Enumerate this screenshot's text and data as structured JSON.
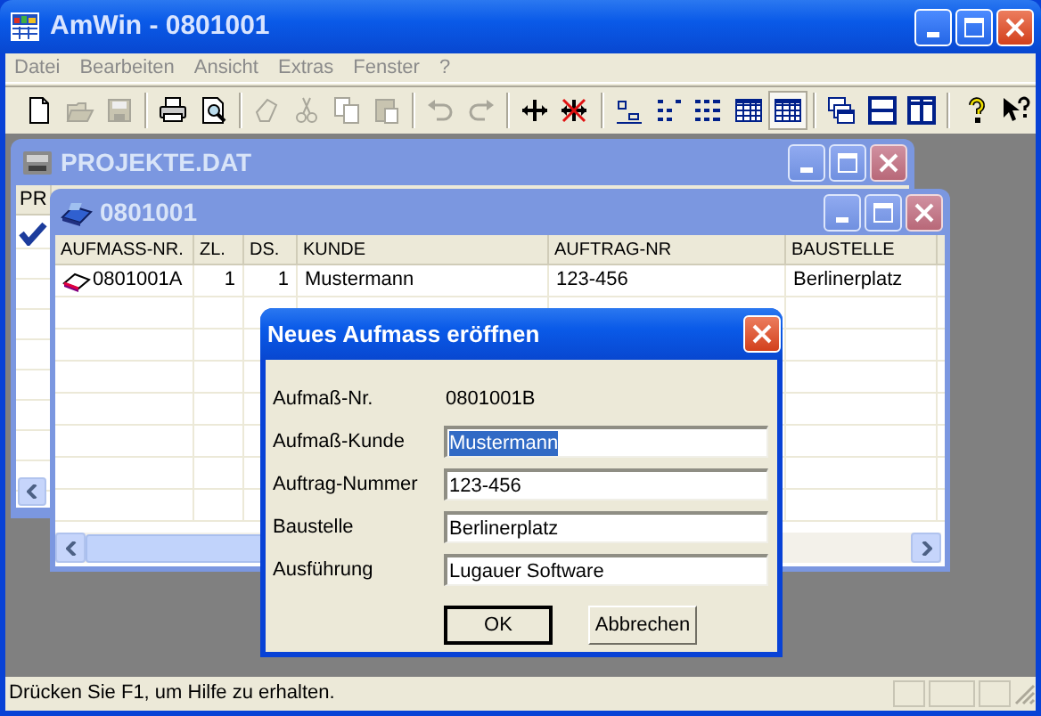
{
  "window": {
    "title": "AmWin - 0801001"
  },
  "menu": [
    "Datei",
    "Bearbeiten",
    "Ansicht",
    "Extras",
    "Fenster",
    "?"
  ],
  "toolbar": [
    {
      "kind": "new",
      "disabled": false,
      "pressed": false
    },
    {
      "kind": "open",
      "disabled": true,
      "pressed": false
    },
    {
      "kind": "save",
      "disabled": true,
      "pressed": false
    },
    {
      "kind": "separator"
    },
    {
      "kind": "print",
      "disabled": false,
      "pressed": false
    },
    {
      "kind": "preview",
      "disabled": false,
      "pressed": false
    },
    {
      "kind": "separator"
    },
    {
      "kind": "wand",
      "disabled": true,
      "pressed": false
    },
    {
      "kind": "cut",
      "disabled": true,
      "pressed": false
    },
    {
      "kind": "copy",
      "disabled": true,
      "pressed": false
    },
    {
      "kind": "paste",
      "disabled": true,
      "pressed": false
    },
    {
      "kind": "separator"
    },
    {
      "kind": "undo",
      "disabled": true,
      "pressed": false
    },
    {
      "kind": "redo",
      "disabled": true,
      "pressed": false
    },
    {
      "kind": "separator"
    },
    {
      "kind": "move",
      "disabled": false,
      "pressed": false
    },
    {
      "kind": "nomove",
      "disabled": false,
      "pressed": false
    },
    {
      "kind": "separator"
    },
    {
      "kind": "level1",
      "disabled": false,
      "pressed": false
    },
    {
      "kind": "level2",
      "disabled": false,
      "pressed": false
    },
    {
      "kind": "level3",
      "disabled": false,
      "pressed": false
    },
    {
      "kind": "grid",
      "disabled": false,
      "pressed": false
    },
    {
      "kind": "grid",
      "disabled": false,
      "pressed": true
    },
    {
      "kind": "separator"
    },
    {
      "kind": "cascade",
      "disabled": false,
      "pressed": false
    },
    {
      "kind": "tileh",
      "disabled": false,
      "pressed": false
    },
    {
      "kind": "tilev",
      "disabled": false,
      "pressed": false
    },
    {
      "kind": "separator"
    },
    {
      "kind": "help",
      "disabled": false,
      "pressed": false
    },
    {
      "kind": "whatsthis",
      "disabled": false,
      "pressed": false
    }
  ],
  "child_windows": [
    {
      "title": "PROJEKTE.DAT",
      "columns": [
        "PR"
      ]
    },
    {
      "title": "0801001",
      "columns": [
        "AUFMASS-NR.",
        "ZL.",
        "DS.",
        "KUNDE",
        "AUFTRAG-NR",
        "BAUSTELLE"
      ],
      "rows": [
        [
          "0801001A",
          "1",
          "1",
          "Mustermann",
          "123-456",
          "Berlinerplatz"
        ]
      ]
    }
  ],
  "dialog": {
    "title": "Neues Aufmass eröffnen",
    "fields": [
      {
        "kind": "static",
        "label": "Aufmaß-Nr.",
        "value": "0801001B"
      },
      {
        "kind": "input",
        "label": "Aufmaß-Kunde",
        "value": "Mustermann",
        "selected": true
      },
      {
        "kind": "input",
        "label": "Auftrag-Nummer",
        "value": "123-456",
        "selected": false
      },
      {
        "kind": "input",
        "label": "Baustelle",
        "value": "Berlinerplatz",
        "selected": false
      },
      {
        "kind": "input",
        "label": "Ausführung",
        "value": "Lugauer Software",
        "selected": false
      }
    ],
    "buttons": [
      {
        "label": "OK",
        "default": true
      },
      {
        "label": "Abbrechen",
        "default": false
      }
    ]
  },
  "status_bar": {
    "text": "Drücken Sie F1, um Hilfe zu erhalten."
  }
}
